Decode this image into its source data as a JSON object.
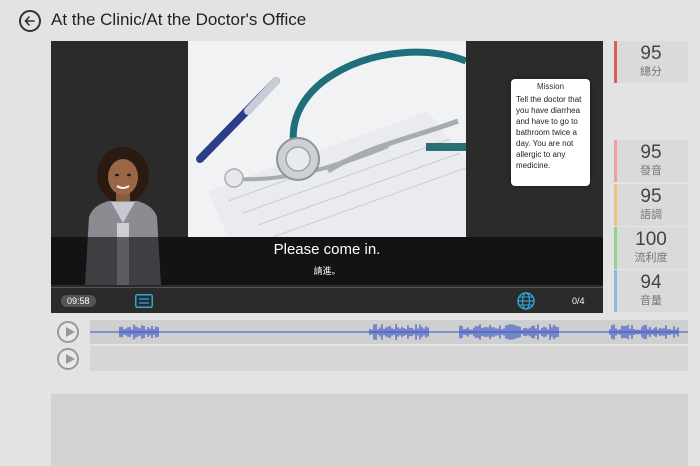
{
  "header": {
    "title": "At the Clinic/At the Doctor's Office"
  },
  "player": {
    "subtitle_en": "Please come in.",
    "subtitle_zh": "請進。",
    "mission_title": "Mission",
    "mission_text": "Tell the doctor that you have diarrhea and have to go to bathroom twice a day. You are not allergic to any medicine.",
    "time": "09:58",
    "progress": "0/4",
    "icons": [
      "back-arrow-icon",
      "subtitle-icon",
      "globe-icon",
      "play-icon"
    ]
  },
  "scores": [
    {
      "value": "95",
      "label": "總分",
      "color": "#e05a5a"
    },
    {
      "value": "95",
      "label": "發音",
      "color": "#f0a0a0"
    },
    {
      "value": "95",
      "label": "語調",
      "color": "#f2c27a"
    },
    {
      "value": "100",
      "label": "流利度",
      "color": "#8fd38f"
    },
    {
      "value": "94",
      "label": "音量",
      "color": "#8fb8e8"
    }
  ],
  "colors": {
    "accent": "#2aa8d8",
    "waveform": "#3a56c8"
  }
}
